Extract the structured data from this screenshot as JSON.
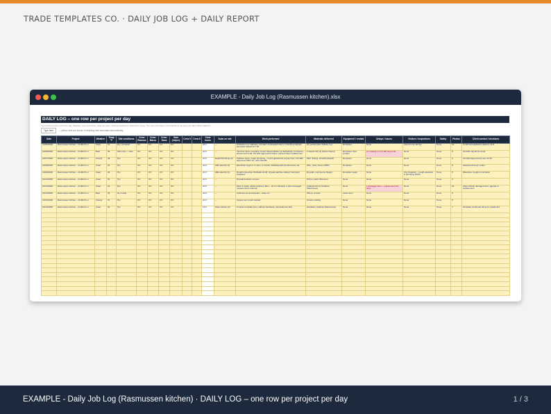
{
  "brand": "TRADE TEMPLATES CO.  ·  DAILY JOB LOG + DAILY REPORT",
  "window": {
    "title": "EXAMPLE - Daily Job Log (Rasmussen kitchen).xlsx"
  },
  "sheet": {
    "title": "DAILY LOG – one row per project per day",
    "note": "Type entries at the end of the day. Weather, crew and hours, what got done, what got delivered, what went wrong. The row you'll want to be thankful in the side you didn't think mattered.",
    "hint_button": "Type here",
    "hint_text": "— yellow cells are inputs. Everything else calculates automatically.",
    "columns": [
      "Date",
      "Project",
      "Weather",
      "Temp °F",
      "Site conditions",
      "Crew Rasmus",
      "Crew Marco",
      "Crew Dana",
      "Crew Sam (helper)",
      "Crew 5",
      "Crew 6",
      "Crew hours",
      "Subs on site",
      "Work performed",
      "Materials delivered",
      "Equipment / rentals",
      "Delays / issues",
      "Visitors / inspections",
      "Safety",
      "Photos",
      "Client contact / decisions"
    ],
    "column_labels": [
      "Date",
      "Project",
      "Weather",
      "Temp °F",
      "Site conditions",
      "Crew: Rasmus",
      "Crew: Marco",
      "Crew: Dana",
      "Sam (helper)",
      "Crew 5",
      "Crew 6",
      "Crew hours",
      "Subs on site",
      "Work performed",
      "Materials delivered",
      "Equipment / rentals",
      "Delays / issues",
      "Visitors / inspections",
      "Safety",
      "Photos",
      "Client contact / decisions"
    ],
    "rows": [
      [
        "10/05/2026",
        "Rasmussen kitchen – 44 Birch Ln",
        "Clear",
        "61",
        "Dry, occupied",
        "8.0",
        "8.0",
        "0.0",
        "8.0",
        "",
        "",
        "24.0",
        "–",
        "Protection up; cabinets, counters, backsplash demo; plumbing capped; dumpster delivered 7:30",
        "20-yd dumpster (Waste Co)",
        "Dumpster",
        "None",
        "Client home all day",
        "None",
        "12",
        "Confirmed appliance delivery 11/4"
      ],
      [
        "10/06/2026",
        "Rasmussen kitchen – 44 Birch Ln",
        "Rain",
        "55",
        "Wet entry – mats",
        "8.0",
        "8.0",
        "0.0",
        "8.0",
        "",
        "",
        "24.0",
        "–",
        "Tile floor demo complete; found rotted subfloor at dishwasher (3 sheets) – photos sent 9:40; CO-001 approved 2:10pm; started sheet replacement",
        "2 sheets 3/4 ply (Home Depot)",
        "Dumpster, floor scraper",
        "2 h waiting on CO-001 approval",
        "None",
        "None",
        "8",
        "CO-001 signed by email"
      ],
      [
        "10/07/2026",
        "Rasmussen kitchen – 44 Birch Ln",
        "Cloudy",
        "58",
        "Dry",
        "8.0",
        "8.0",
        "0.0",
        "4.0",
        "",
        "",
        "20.0",
        "Rapid Plumbing (2)",
        "Subfloor done; rough plumbing – found galvanized supply lines, CO-002 approved; PEX run, new shutoffs",
        "PEX, fittings, shutoffs (Rapid)",
        "Dumpster",
        "None",
        "None",
        "None",
        "6",
        "CO-002 approved by text 11:35"
      ],
      [
        "10/08/2026",
        "Rasmussen kitchen – 44 Birch Ln",
        "Clear",
        "63",
        "Dry",
        "8.0",
        "8.0",
        "0.0",
        "8.0",
        "",
        "",
        "24.0",
        "ABC Electric (2)",
        "Electrical rough-in: 4 cans, 2 circuits, DW/disposal circuits boxes set",
        "Wire, cans, boxes (ABC)",
        "Dumpster",
        "None",
        "None",
        "None",
        "8",
        "Selected dimmer model"
      ],
      [
        "10/09/2026",
        "Rasmussen kitchen – 44 Birch Ln",
        "Clear",
        "66",
        "Dry",
        "8.0",
        "8.0",
        "0.0",
        "8.0",
        "",
        "",
        "24.0",
        "ABC Electric (1)",
        "Rough inspection PASSED 10:30; drywall patches started; dumpster swapped",
        "Drywall, mud (Home Depot)",
        "Dumpster swap",
        "None",
        "City inspector – rough electrical & plumbing PASS",
        "None",
        "5",
        "Milestone: rough-in complete"
      ],
      [
        "10/12/2026",
        "Rasmussen kitchen – 44 Birch Ln",
        "Clear",
        "60",
        "Dry",
        "8.0",
        "8.0",
        "0.0",
        "8.0",
        "",
        "",
        "24.0",
        "–",
        "Drywall finished, primed",
        "Primer, paint (Sherwin)",
        "None",
        "None",
        "None",
        "None",
        "4",
        ""
      ],
      [
        "10/13/2026",
        "Rasmussen kitchen – 44 Birch Ln",
        "Clear",
        "62",
        "Dry",
        "8.0",
        "8.0",
        "0.0",
        "8.0",
        "",
        "",
        "24.0",
        "–",
        "Paint 2 coats; cabinet delivery 8am – 22 LF checked, 1 door damaged (replacement ordered)",
        "Cabinets 22 LF (Cabinet Warehouse)",
        "None",
        "1 damaged door – replacement 10 days",
        "None",
        "None",
        "10",
        "Client shown damaged door, agreed to replacement"
      ],
      [
        "10/14/2026",
        "Rasmussen kitchen – 44 Birch Ln",
        "Rain",
        "54",
        "Dry inside",
        "8.0",
        "8.0",
        "0.0",
        "8.0",
        "",
        "",
        "24.0",
        "–",
        "Cabinets set and leveled – base run",
        "Shims, screws",
        "Laser level",
        "None",
        "None",
        "None",
        "6",
        ""
      ],
      [
        "10/15/2026",
        "Rasmussen kitchen – 44 Birch Ln",
        "Cloudy",
        "57",
        "Dry",
        "8.0",
        "8.0",
        "0.0",
        "8.0",
        "",
        "",
        "24.0",
        "–",
        "Uppers set; crown started",
        "Crown molding",
        "None",
        "None",
        "None",
        "None",
        "5",
        ""
      ],
      [
        "10/16/2026",
        "Rasmussen kitchen – 44 Birch Ln",
        "Clear",
        "64",
        "Dry",
        "8.0",
        "4.0",
        "0.0",
        "4.0",
        "",
        "",
        "16.0",
        "Stone Works (2)",
        "Counter template 1pm; cabinet hardware; peninsula toe kick",
        "Hardware (Cabinet Warehouse)",
        "None",
        "None",
        "None",
        "None",
        "7",
        "Template confirmed 45 sq ft, install 11/4"
      ]
    ],
    "empty_row_count": 18,
    "warn_color": "#f7d2d8"
  },
  "footer": {
    "text": "EXAMPLE - Daily Job Log (Rasmussen kitchen) · DAILY LOG – one row per project per day",
    "pager": "1 / 3"
  }
}
